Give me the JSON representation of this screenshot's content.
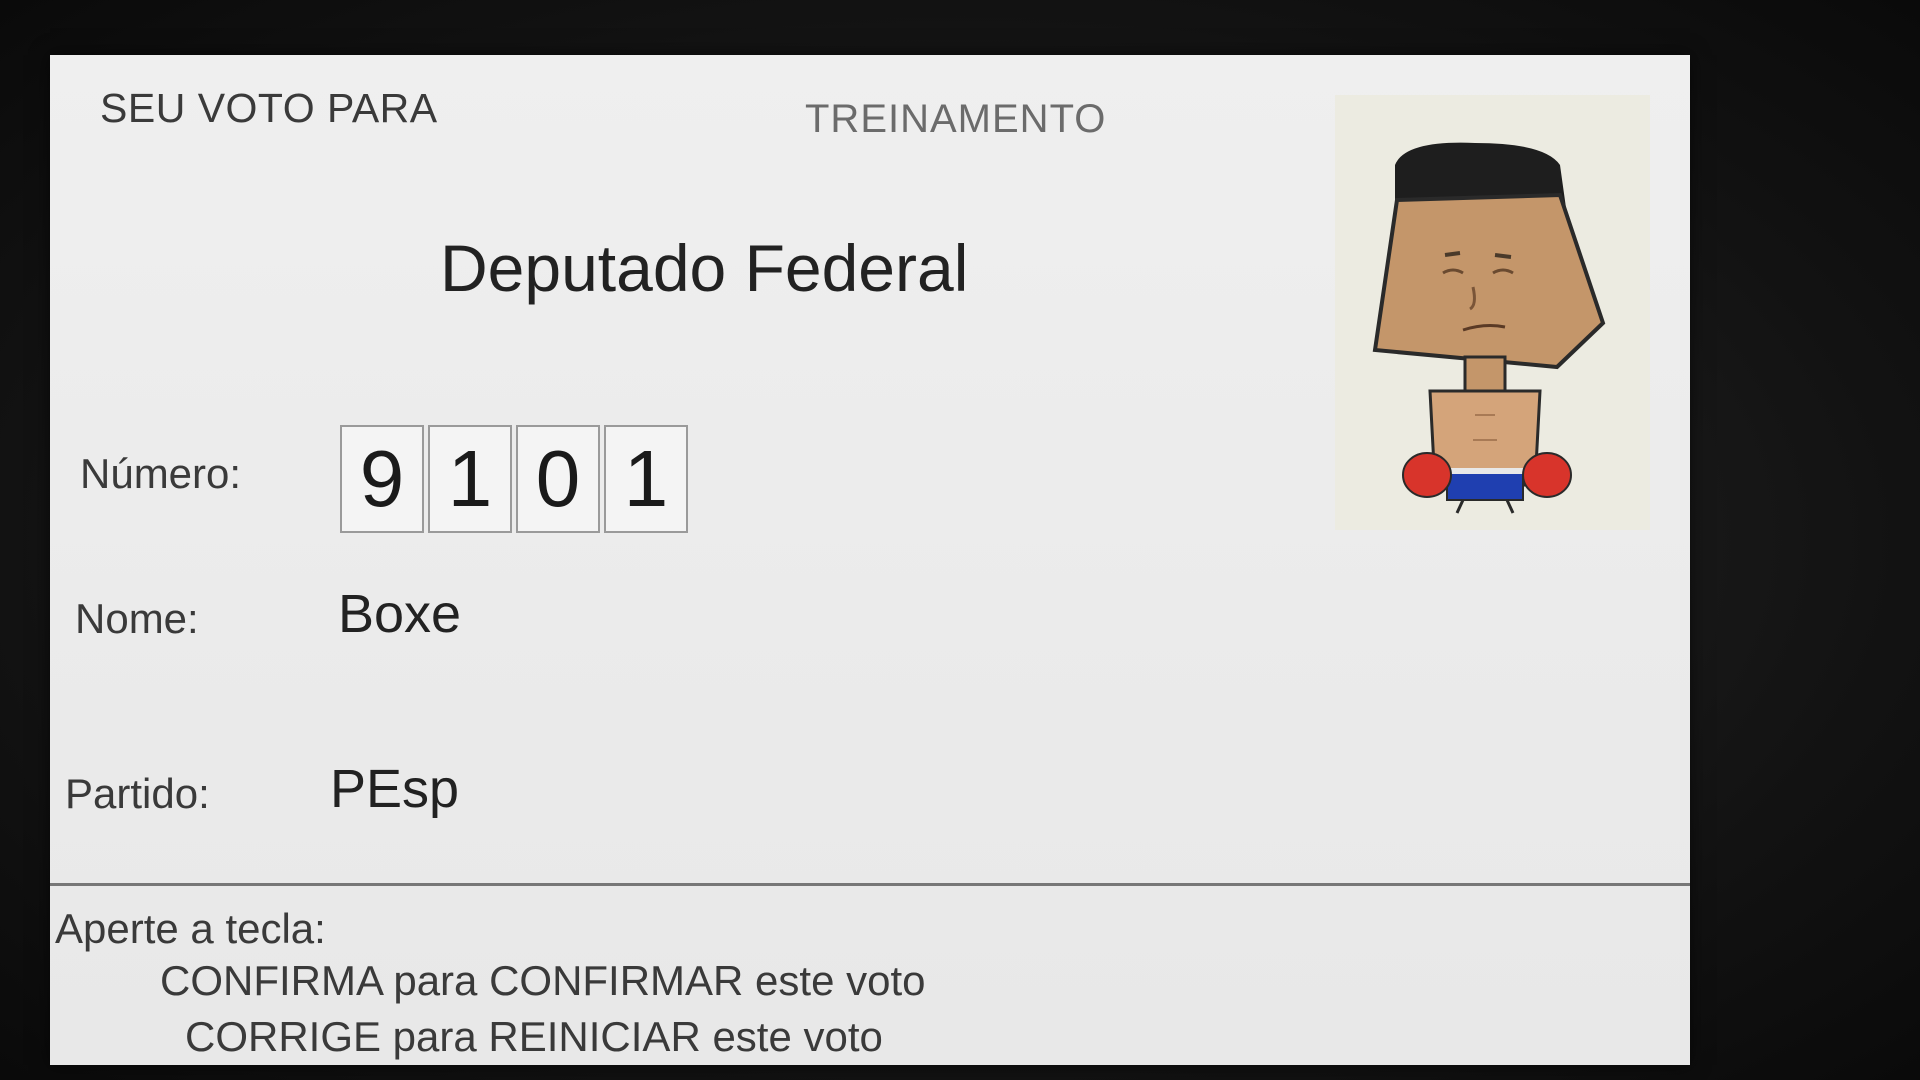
{
  "header": {
    "left_title": "SEU VOTO PARA",
    "center_title": "TREINAMENTO"
  },
  "office": "Deputado Federal",
  "fields": {
    "numero_label": "Número:",
    "digits": [
      "9",
      "1",
      "0",
      "1"
    ],
    "nome_label": "Nome:",
    "nome_value": "Boxe",
    "partido_label": "Partido:",
    "partido_value": "PEsp"
  },
  "candidate_photo": {
    "icon": "boxer-cartoon-icon"
  },
  "footer": {
    "instruction": "Aperte a tecla:",
    "line1": "CONFIRMA para CONFIRMAR este voto",
    "line2": "CORRIGE para REINICIAR este voto"
  },
  "colors": {
    "screen_bg": "#ebebeb",
    "text": "#3a3a3a",
    "photo_bg": "#ecebe1"
  }
}
